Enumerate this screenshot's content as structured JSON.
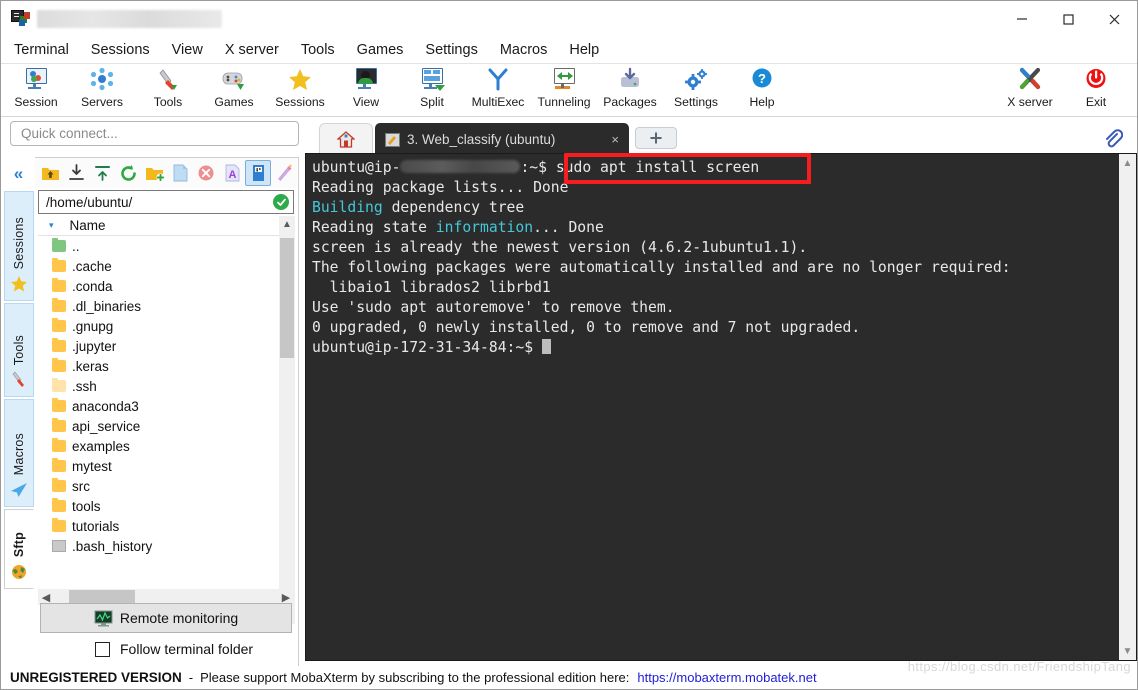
{
  "window": {
    "title_redacted": true,
    "minimize_label": "Minimize",
    "maximize_label": "Maximize",
    "close_label": "Close"
  },
  "menubar": {
    "items": [
      {
        "label": "Terminal"
      },
      {
        "label": "Sessions"
      },
      {
        "label": "View"
      },
      {
        "label": "X server"
      },
      {
        "label": "Tools"
      },
      {
        "label": "Games"
      },
      {
        "label": "Settings"
      },
      {
        "label": "Macros"
      },
      {
        "label": "Help"
      }
    ]
  },
  "toolbar": {
    "left_buttons": [
      {
        "label": "Session",
        "icon": "session-monitor-icon"
      },
      {
        "label": "Servers",
        "icon": "servers-network-icon"
      },
      {
        "label": "Tools",
        "icon": "tools-knife-icon"
      },
      {
        "label": "Games",
        "icon": "games-gamepad-icon"
      },
      {
        "label": "Sessions",
        "icon": "sessions-star-icon"
      },
      {
        "label": "View",
        "icon": "view-monitor-icon"
      },
      {
        "label": "Split",
        "icon": "split-panes-icon"
      },
      {
        "label": "MultiExec",
        "icon": "multiexec-fork-icon"
      },
      {
        "label": "Tunneling",
        "icon": "tunneling-arrows-icon"
      },
      {
        "label": "Packages",
        "icon": "packages-download-icon"
      },
      {
        "label": "Settings",
        "icon": "settings-gear-icon"
      },
      {
        "label": "Help",
        "icon": "help-question-icon"
      }
    ],
    "right_buttons": [
      {
        "label": "X server",
        "icon": "x-server-icon"
      },
      {
        "label": "Exit",
        "icon": "power-exit-icon"
      }
    ]
  },
  "quick_connect": {
    "placeholder": "Quick connect...",
    "value": ""
  },
  "side_tabs": {
    "collapse_label": "«",
    "items": [
      {
        "label": "Sessions",
        "icon": "star-icon",
        "active": false
      },
      {
        "label": "Tools",
        "icon": "knife-icon",
        "active": false
      },
      {
        "label": "Macros",
        "icon": "paper-plane-icon",
        "active": false
      },
      {
        "label": "Sftp",
        "icon": "globe-icon",
        "active": true
      }
    ]
  },
  "file_browser": {
    "toolbar_icons": [
      {
        "name": "go-up-folder-icon",
        "selected": false
      },
      {
        "name": "download-icon",
        "selected": false
      },
      {
        "name": "upload-icon",
        "selected": false
      },
      {
        "name": "refresh-icon",
        "selected": false
      },
      {
        "name": "new-folder-icon",
        "selected": false
      },
      {
        "name": "new-file-icon",
        "selected": false
      },
      {
        "name": "delete-icon",
        "selected": false
      },
      {
        "name": "text-mode-icon",
        "selected": false
      },
      {
        "name": "binary-mode-icon",
        "selected": true
      },
      {
        "name": "edit-wand-icon",
        "selected": false
      }
    ],
    "path": "/home/ubuntu/",
    "path_status": "ok",
    "column_header": "Name",
    "sort_indicator": "▾",
    "entries": [
      {
        "name": "..",
        "type": "parent"
      },
      {
        "name": ".cache",
        "type": "folder"
      },
      {
        "name": ".conda",
        "type": "folder"
      },
      {
        "name": ".dl_binaries",
        "type": "folder"
      },
      {
        "name": ".gnupg",
        "type": "folder"
      },
      {
        "name": ".jupyter",
        "type": "folder"
      },
      {
        "name": ".keras",
        "type": "folder"
      },
      {
        "name": ".ssh",
        "type": "folder-pale"
      },
      {
        "name": "anaconda3",
        "type": "folder"
      },
      {
        "name": "api_service",
        "type": "folder"
      },
      {
        "name": "examples",
        "type": "folder"
      },
      {
        "name": "mytest",
        "type": "folder"
      },
      {
        "name": "src",
        "type": "folder"
      },
      {
        "name": "tools",
        "type": "folder"
      },
      {
        "name": "tutorials",
        "type": "folder"
      },
      {
        "name": ".bash_history",
        "type": "file"
      }
    ],
    "remote_monitoring_label": "Remote monitoring",
    "follow_terminal_label": "Follow terminal folder",
    "follow_terminal_checked": false
  },
  "tabs": {
    "home_tab_icon": "home-icon",
    "active_tab": {
      "label": "3. Web_classify (ubuntu)",
      "close_label": "×"
    },
    "new_tab_label": "✚"
  },
  "terminal": {
    "lines": [
      {
        "segments": [
          {
            "text": "ubuntu@ip-",
            "color": "#e8e8e8"
          },
          {
            "text": "",
            "redacted": true
          },
          {
            "text": ":~$ ",
            "color": "#e8e8e8"
          },
          {
            "text": "sudo apt install screen",
            "color": "#e8e8e8"
          }
        ]
      },
      {
        "segments": [
          {
            "text": "Reading package lists... Done",
            "color": "#e8e8e8"
          }
        ]
      },
      {
        "segments": [
          {
            "text": "Building",
            "color": "#45c7d6"
          },
          {
            "text": " dependency tree",
            "color": "#e8e8e8"
          }
        ]
      },
      {
        "segments": [
          {
            "text": "Reading state ",
            "color": "#e8e8e8"
          },
          {
            "text": "information",
            "color": "#45c7d6"
          },
          {
            "text": "... Done",
            "color": "#e8e8e8"
          }
        ]
      },
      {
        "segments": [
          {
            "text": "screen is already the newest version (4.6.2-1ubuntu1.1).",
            "color": "#e8e8e8"
          }
        ]
      },
      {
        "segments": [
          {
            "text": "The following packages were automatically installed and are no longer required:",
            "color": "#e8e8e8"
          }
        ]
      },
      {
        "segments": [
          {
            "text": "  libaio1 librados2 librbd1",
            "color": "#e8e8e8"
          }
        ]
      },
      {
        "segments": [
          {
            "text": "Use 'sudo apt autoremove' to remove them.",
            "color": "#e8e8e8"
          }
        ]
      },
      {
        "segments": [
          {
            "text": "0 upgraded, 0 newly installed, 0 to remove and 7 not upgraded.",
            "color": "#e8e8e8"
          }
        ]
      },
      {
        "segments": [
          {
            "text": "ubuntu@ip-172-31-34-84:~$ ",
            "color": "#e8e8e8"
          },
          {
            "cursor": true
          }
        ]
      }
    ],
    "highlight_annotation": {
      "text": "sudo apt install screen",
      "color": "#f51d1d"
    },
    "background": "#2b2b2b",
    "foreground": "#e8e8e8",
    "accent": "#45c7d6"
  },
  "statusbar": {
    "unregistered": "UNREGISTERED VERSION",
    "dash": "-",
    "message": "Please support MobaXterm by subscribing to the professional edition here:",
    "link": "https://mobaxterm.mobatek.net"
  },
  "watermark": "https://blog.csdn.net/FriendshipTang"
}
